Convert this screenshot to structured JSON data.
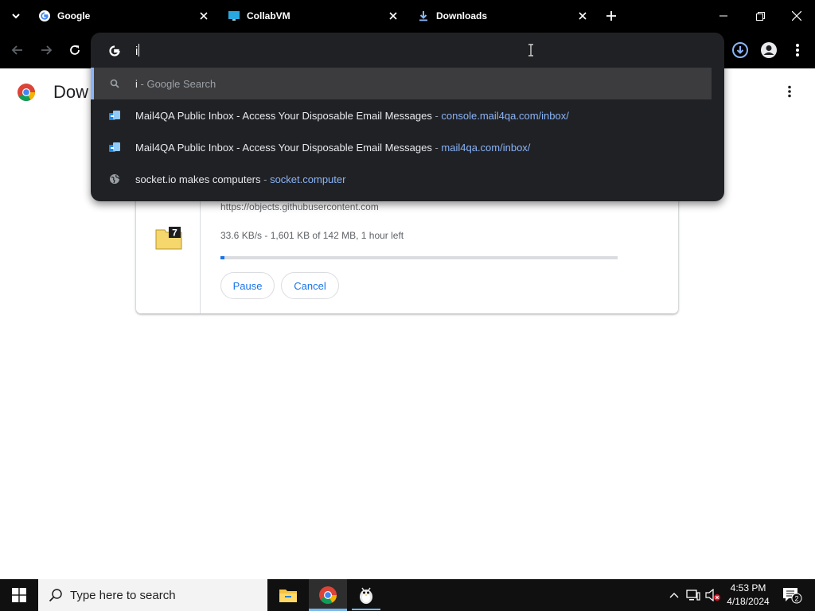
{
  "browser": {
    "tabs": [
      {
        "title": "Google",
        "favicon": "google-g-icon"
      },
      {
        "title": "CollabVM",
        "favicon": "monitor-icon"
      },
      {
        "title": "Downloads",
        "favicon": "download-arrow-icon",
        "active": true
      }
    ]
  },
  "omnibox": {
    "input_value": "i",
    "suggestions": [
      {
        "text": "i",
        "sep": " - ",
        "url": "Google Search",
        "icon": "search-icon",
        "selected": true
      },
      {
        "text": "Mail4QA Public Inbox - Access Your Disposable Email Messages",
        "sep": " - ",
        "url": "console.mail4qa.com/inbox/",
        "icon": "mail4qa-icon"
      },
      {
        "text": "Mail4QA Public Inbox - Access Your Disposable Email Messages",
        "sep": " - ",
        "url": "mail4qa.com/inbox/",
        "icon": "mail4qa-icon"
      },
      {
        "text": "socket.io makes computers",
        "sep": " - ",
        "url": "socket.computer",
        "icon": "globe-icon"
      }
    ]
  },
  "page": {
    "title": "Dow",
    "download": {
      "url": "https://objects.githubusercontent.com",
      "status": "33.6 KB/s - 1,601 KB of 142 MB, 1 hour left",
      "progress_fraction": 0.011,
      "pause_label": "Pause",
      "cancel_label": "Cancel",
      "file_icon_badge": "7"
    }
  },
  "taskbar": {
    "search_placeholder": "Type here to search",
    "time": "4:53 PM",
    "date": "4/18/2024",
    "notification_count": "2"
  },
  "colors": {
    "accent": "#8ab4f8",
    "progress": "#1a73e8",
    "popup_bg": "#202124"
  }
}
